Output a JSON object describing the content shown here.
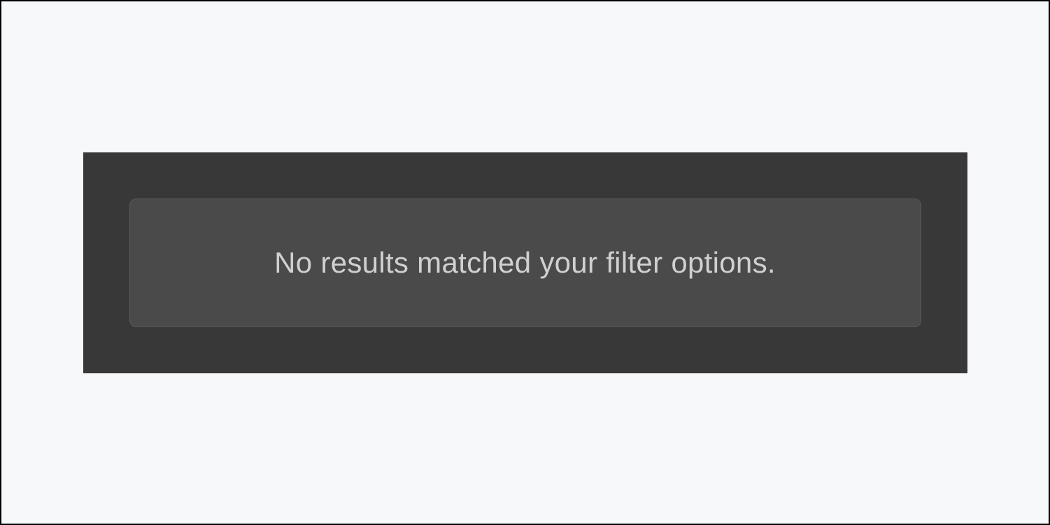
{
  "empty_state": {
    "message": "No results matched your filter options."
  }
}
